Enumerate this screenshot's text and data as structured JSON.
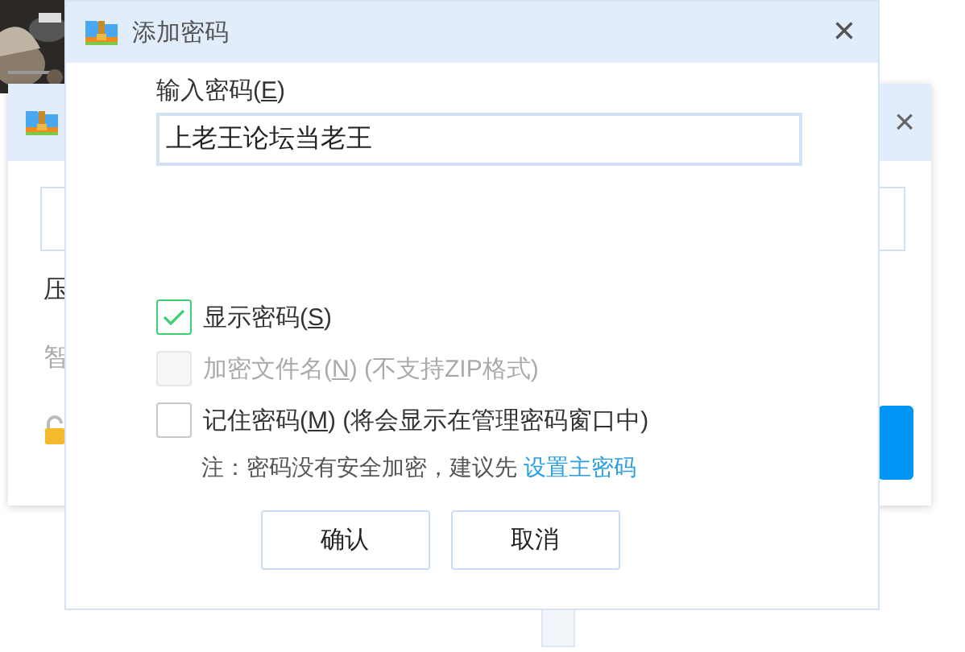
{
  "background_window": {
    "close": "×",
    "texts": [
      {
        "text": "压",
        "kind": "normal"
      },
      {
        "text": "智",
        "kind": "muted"
      }
    ]
  },
  "dialog": {
    "title": "添加密码",
    "close": "×",
    "password_field": {
      "label": "输入密码(",
      "access_key": "E",
      "label_end": ")",
      "value": "上老王论坛当老王"
    },
    "options": [
      {
        "label": "显示密码(",
        "access_key": "S",
        "label_end": ")",
        "checked": true,
        "disabled": false
      },
      {
        "label": "加密文件名(",
        "access_key": "N",
        "label_end": ") (不支持ZIP格式)",
        "checked": false,
        "disabled": true
      },
      {
        "label": "记住密码(",
        "access_key": "M",
        "label_end": ") (将会显示在管理密码窗口中)",
        "checked": false,
        "disabled": false
      }
    ],
    "note": {
      "text": "注：密码没有安全加密，建议先",
      "link": "设置主密码"
    },
    "buttons": [
      "确认",
      "取消"
    ]
  }
}
